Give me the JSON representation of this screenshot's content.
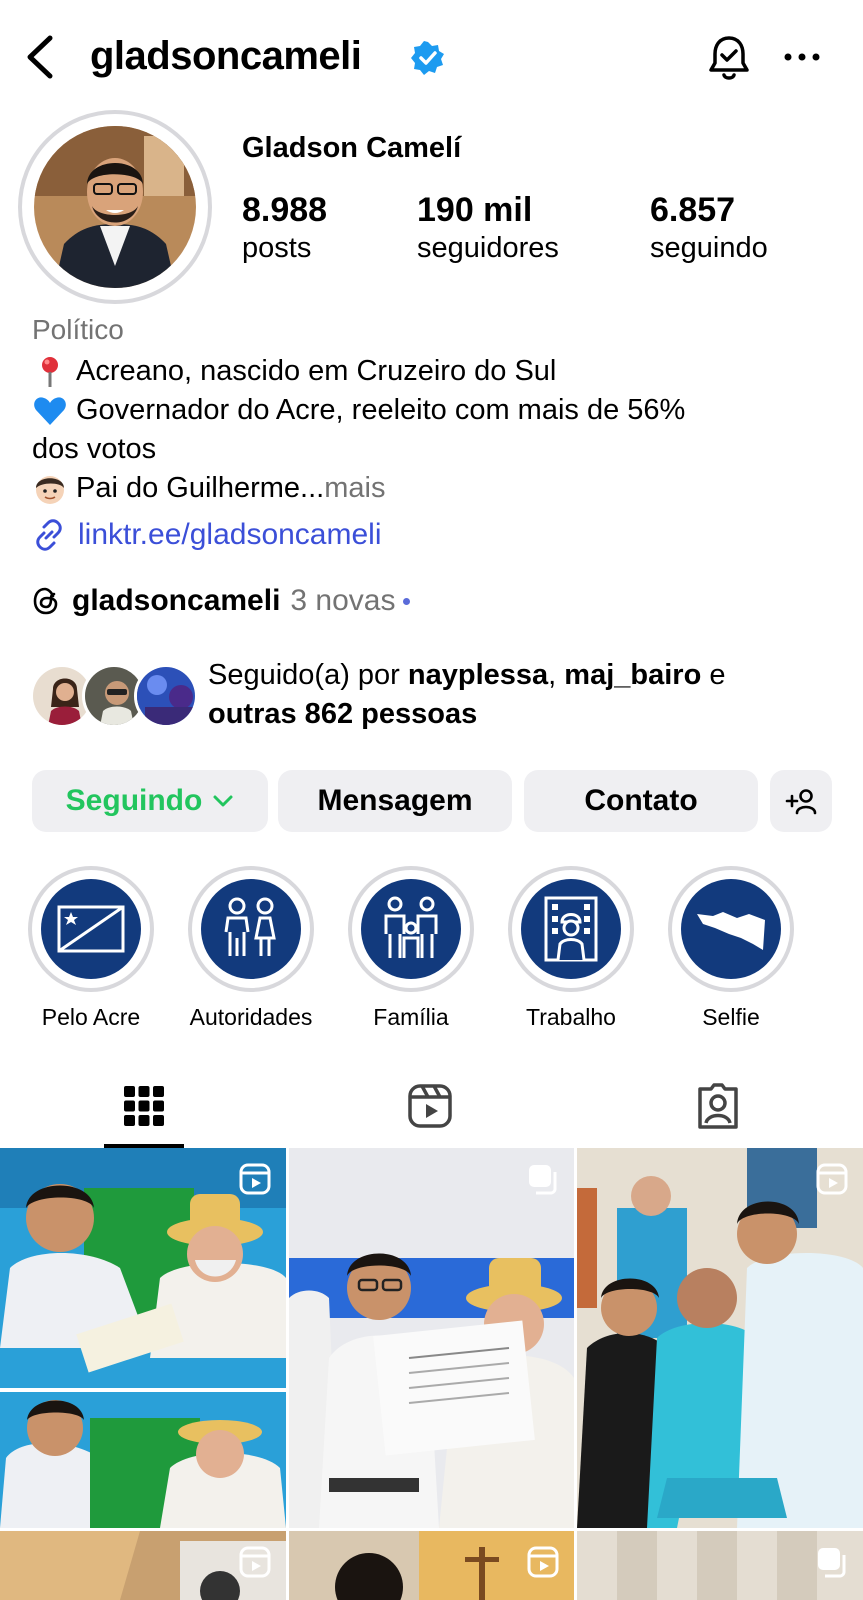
{
  "header": {
    "username": "gladsoncameli",
    "icons": [
      "back-arrow-icon",
      "verified-badge-icon",
      "notification-bell-icon",
      "more-options-icon"
    ]
  },
  "profile": {
    "full_name": "Gladson Camelí",
    "stats": [
      {
        "value": "8.988",
        "label": "posts"
      },
      {
        "value": "190 mil",
        "label": "seguidores"
      },
      {
        "value": "6.857",
        "label": "seguindo"
      }
    ],
    "category": "Político",
    "bio_lines": [
      "Acreano, nascido em Cruzeiro do Sul",
      "Governador do Acre, reeleito com mais de 56%",
      "dos votos",
      "Pai do Guilherme..."
    ],
    "bio_more": " mais",
    "link": "linktr.ee/gladsoncameli",
    "threads": {
      "name": "gladsoncameli",
      "new": "3 novas"
    },
    "followed_by": {
      "prefix": "Seguido(a) por ",
      "user1": "nayplessa",
      "sep": ", ",
      "user2": "maj_bairo",
      "and": " e",
      "others": "outras 862 pessoas"
    }
  },
  "actions": {
    "following": "Seguindo",
    "message": "Mensagem",
    "contact": "Contato"
  },
  "highlights": [
    {
      "label": "Pelo Acre"
    },
    {
      "label": "Autoridades"
    },
    {
      "label": "Família"
    },
    {
      "label": "Trabalho"
    },
    {
      "label": "Selfie"
    }
  ],
  "tabs": [
    "grid-icon",
    "reels-icon",
    "tagged-icon"
  ],
  "colors": {
    "accent_green": "#22c55e",
    "link_blue": "#3b4fd8",
    "verified_blue": "#1d9bf0",
    "highlight_navy": "#123a7d",
    "button_bg": "#efeff2"
  }
}
